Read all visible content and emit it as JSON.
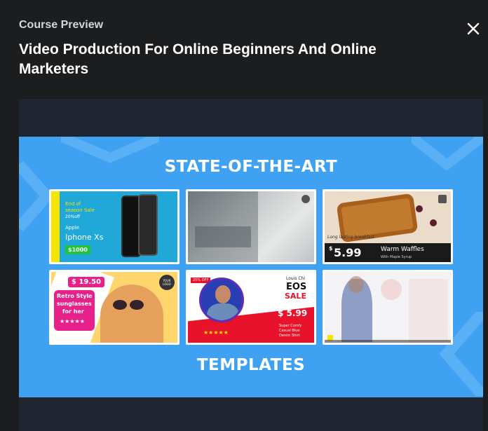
{
  "header": {
    "eyebrow": "Course Preview",
    "title": "Video Production For Online Beginners And Online Marketers"
  },
  "preview": {
    "headline_top": "STATE-OF-THE-ART",
    "headline_bottom": "TEMPLATES",
    "thumbs": {
      "iphone": {
        "line1": "End of",
        "line2": "season Sale",
        "line3": "20%off",
        "brand": "Apple",
        "model": "Iphone Xs",
        "price": "$1000"
      },
      "waffles": {
        "caption": "Long lasting breakfast",
        "dollar": "$",
        "price": "5.99",
        "title": "Warm Waffles",
        "subtitle": "With Maple Syrup"
      },
      "retro": {
        "price": "$ 19.50",
        "line1": "Retro Style",
        "line2": "sunglasses",
        "line3": "for her",
        "logo": "YOUR LOGO"
      },
      "eos": {
        "badge": "25% OFF",
        "brand": "Louis Chi",
        "title1": "EOS",
        "title2": "SALE",
        "price": "$ 5.99",
        "desc1": "Super Comfy",
        "desc2": "Casual Blue",
        "desc3": "Denim Shirt"
      }
    }
  },
  "colors": {
    "page_bg": "#1c1d1f",
    "frame_bg": "#3fa1f2",
    "accent_yellow": "#f5e400",
    "accent_red": "#e8122a",
    "accent_pink": "#e8208a"
  }
}
